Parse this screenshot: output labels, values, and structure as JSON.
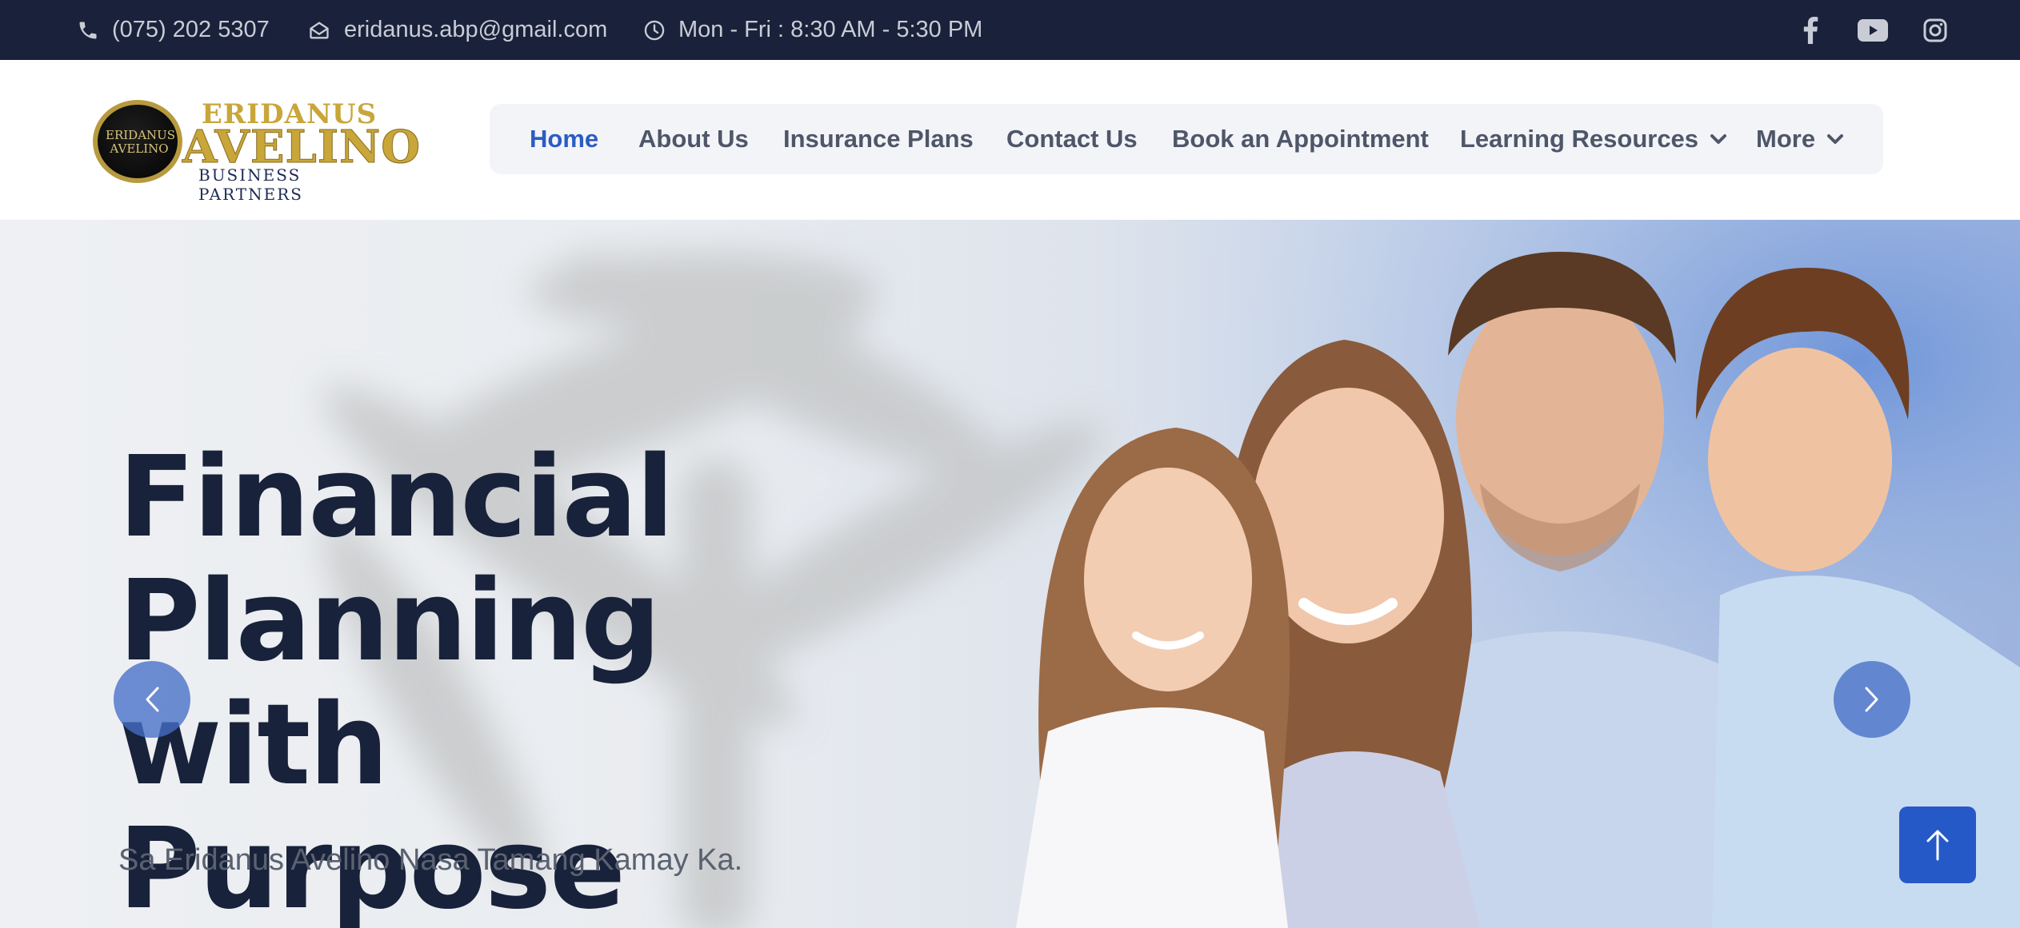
{
  "topbar": {
    "phone": "(075) 202 5307",
    "email": "eridanus.abp@gmail.com",
    "hours": "Mon - Fri : 8:30 AM - 5:30 PM",
    "social_icons": [
      "facebook-icon",
      "youtube-icon",
      "instagram-icon"
    ]
  },
  "logo": {
    "monogram": "ERIDANUS AVELINO",
    "word1": "ERIDANUS",
    "word2": "AVELINO",
    "word3": "BUSINESS PARTNERS"
  },
  "nav": {
    "items": [
      {
        "label": "Home",
        "active": true
      },
      {
        "label": "About Us"
      },
      {
        "label": "Insurance Plans"
      },
      {
        "label": "Contact Us"
      },
      {
        "label": "Book an Appointment"
      },
      {
        "label": "Learning Resources",
        "dropdown": true
      },
      {
        "label": "More",
        "dropdown": true
      }
    ]
  },
  "hero": {
    "title_line1": "Financial",
    "title_line2": "Planning with",
    "title_line3": "Purpose",
    "subtitle": "Sa Eridanus Avelino Nasa Tamang Kamay Ka."
  },
  "colors": {
    "topbar_bg": "#19223a",
    "accent_blue": "#2b5cc4",
    "title_dark": "#18223a",
    "logo_gold": "#c9a63a"
  }
}
